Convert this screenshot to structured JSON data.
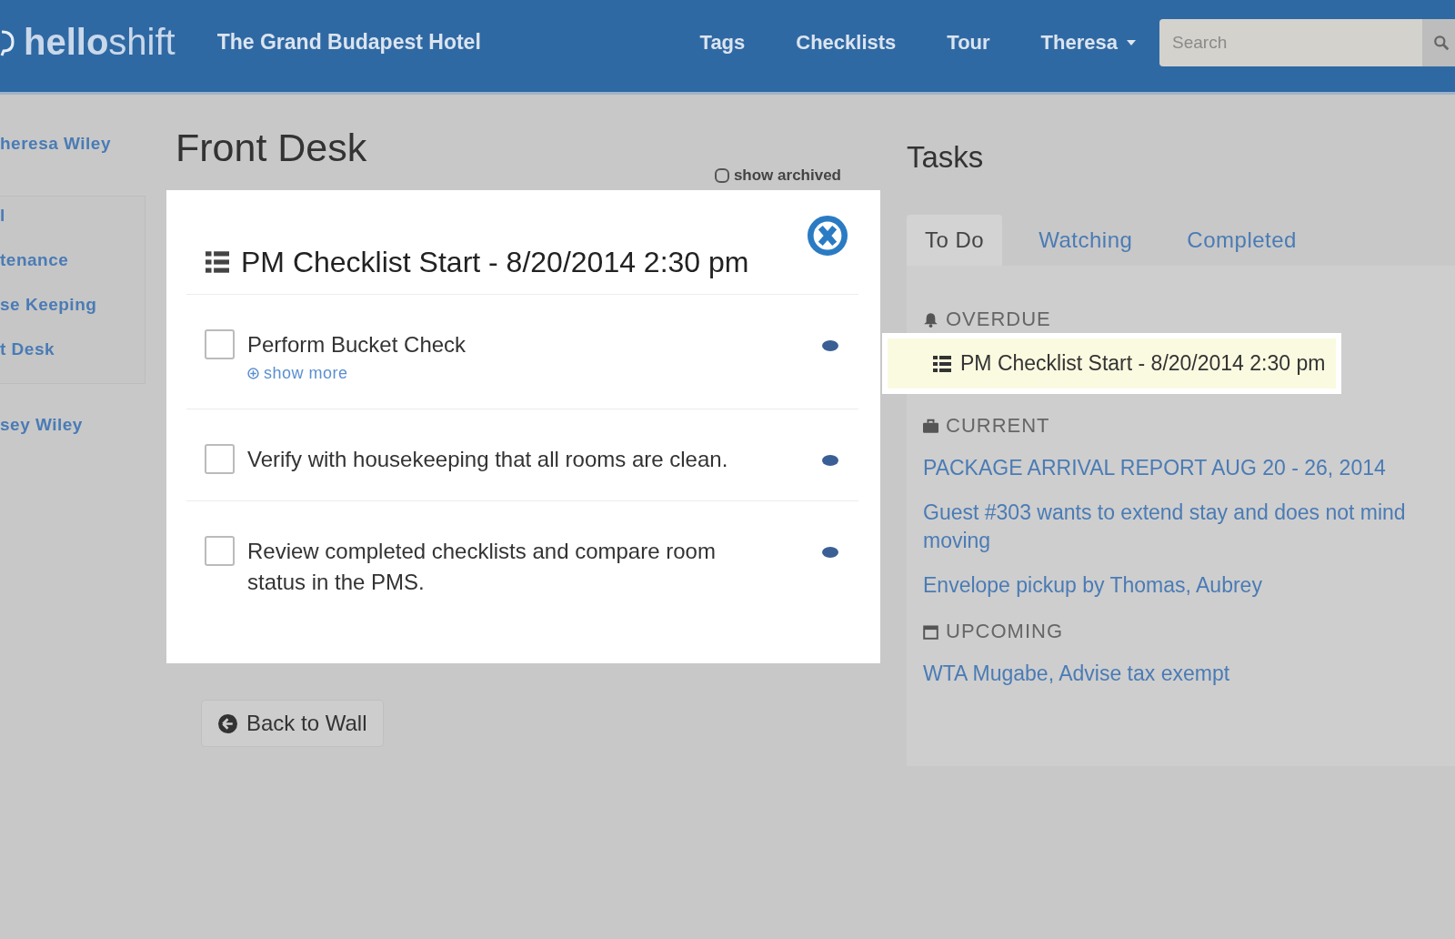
{
  "header": {
    "logo": "**hello**shift",
    "hotel": "The Grand Budapest Hotel",
    "nav": [
      {
        "label": "Tags",
        "kind": "link"
      },
      {
        "label": "Checklists",
        "kind": "link"
      },
      {
        "label": "Tour",
        "kind": "link"
      },
      {
        "label": "Theresa",
        "kind": "dropdown"
      }
    ],
    "search": {
      "placeholder": "Search"
    }
  },
  "sidebar": {
    "user": "heresa Wiley",
    "items": [
      "l",
      "tenance",
      "se Keeping",
      "t Desk"
    ],
    "other_user": "sey Wiley"
  },
  "page": {
    "title": "Front Desk",
    "show_archived": {
      "label": "show archived",
      "checked": false
    },
    "back_button": "Back to Wall"
  },
  "modal": {
    "title": "PM Checklist Start - 8/20/2014 2:30 pm",
    "items": [
      {
        "text": "Perform Bucket Check",
        "checked": false,
        "more": "show more"
      },
      {
        "text": "Verify with housekeeping that all rooms are clean.",
        "checked": false
      },
      {
        "text": "Review completed checklists and compare room status in the PMS.",
        "checked": false
      }
    ]
  },
  "tasks": {
    "title": "Tasks",
    "tabs": [
      {
        "label": "To Do",
        "selected": true
      },
      {
        "label": "Watching",
        "selected": false
      },
      {
        "label": "Completed",
        "selected": false
      }
    ],
    "sections": [
      {
        "kind": "overdue",
        "heading": "OVERDUE",
        "items": [
          {
            "text": "PM Checklist Start - 8/20/2014 2:30 pm",
            "kind": "checklist",
            "highlighted": true
          }
        ]
      },
      {
        "kind": "current",
        "heading": "CURRENT",
        "items": [
          {
            "text": "PACKAGE ARRIVAL REPORT AUG 20 - 26, 2014",
            "kind": "task",
            "highlighted": false
          },
          {
            "text": "Guest #303 wants to extend stay and does not mind moving",
            "kind": "task",
            "highlighted": false
          },
          {
            "text": "Envelope pickup by Thomas, Aubrey",
            "kind": "task",
            "highlighted": false
          }
        ]
      },
      {
        "kind": "upcoming",
        "heading": "UPCOMING",
        "items": [
          {
            "text": "WTA Mugabe, Advise tax exempt",
            "kind": "task",
            "highlighted": false
          }
        ]
      }
    ]
  }
}
